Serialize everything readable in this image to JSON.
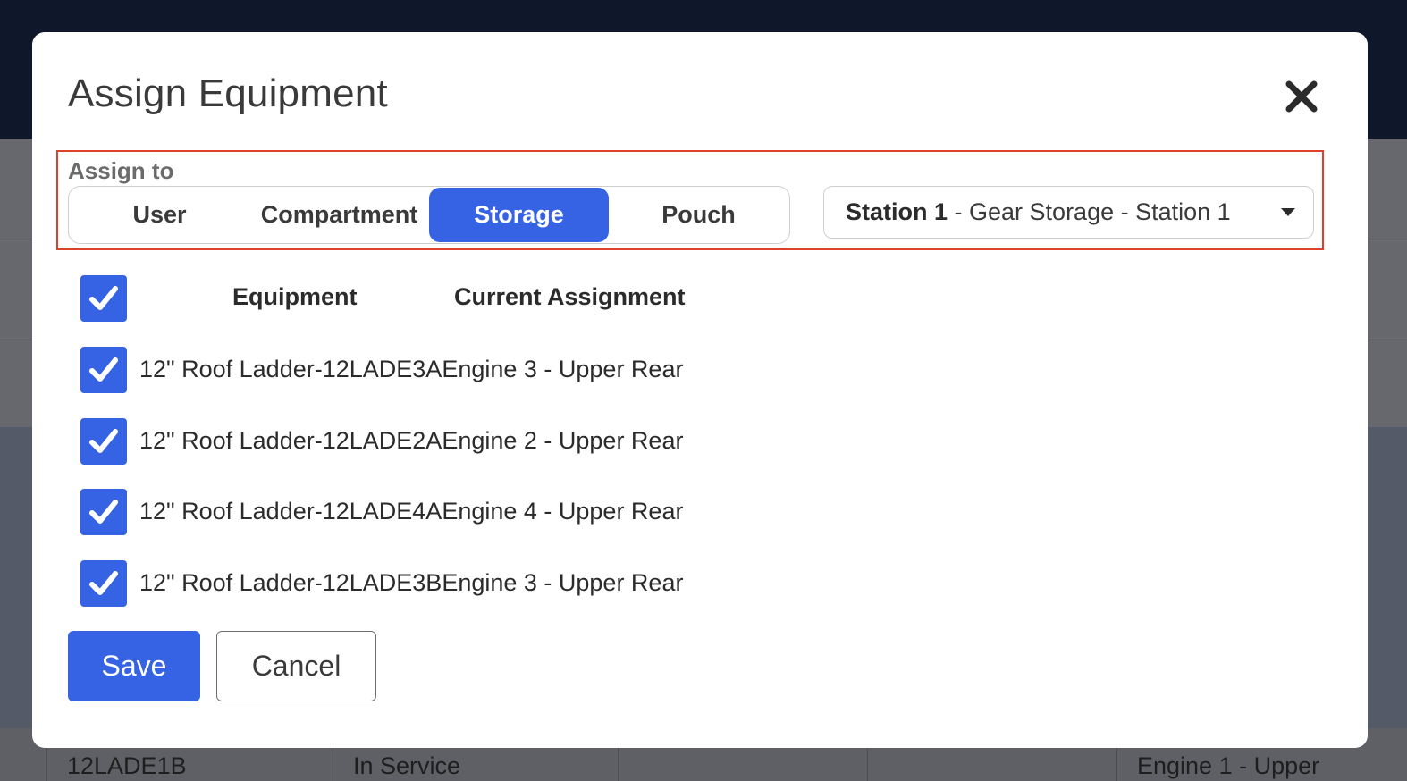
{
  "modal": {
    "title": "Assign Equipment",
    "close_icon": "close-icon",
    "assign_to": {
      "label": "Assign to",
      "options": [
        "User",
        "Compartment",
        "Storage",
        "Pouch"
      ],
      "selected": "Storage"
    },
    "location_select": {
      "station": "Station 1",
      "rest": " - Gear Storage - Station 1",
      "icon": "caret-down-icon"
    },
    "table": {
      "headers": [
        "Equipment",
        "Current Assignment"
      ],
      "select_all_checked": true,
      "rows": [
        {
          "equipment": "12\" Roof Ladder-12LADE3A",
          "assignment": "Engine 3 - Upper Rear",
          "checked": true
        },
        {
          "equipment": "12\" Roof Ladder-12LADE2A",
          "assignment": "Engine 2 - Upper Rear",
          "checked": true
        },
        {
          "equipment": "12\" Roof Ladder-12LADE4A",
          "assignment": "Engine 4 - Upper Rear",
          "checked": true
        },
        {
          "equipment": "12\" Roof Ladder-12LADE3B",
          "assignment": "Engine 3 - Upper Rear",
          "checked": true
        }
      ]
    },
    "save_label": "Save",
    "cancel_label": "Cancel"
  },
  "background": {
    "row": [
      "12LADE1B",
      "In Service",
      "",
      "",
      "Engine 1 - Upper"
    ]
  },
  "colors": {
    "accent": "#3563e4",
    "highlight": "#e0412b",
    "topbar": "#0f172a"
  }
}
